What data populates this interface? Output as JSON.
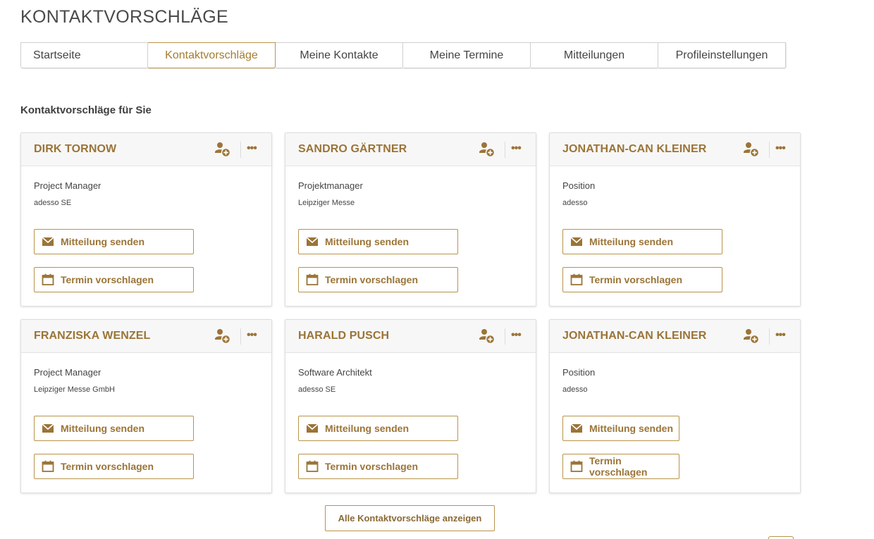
{
  "page": {
    "title": "KONTAKTVORSCHLÄGE"
  },
  "tabs": [
    {
      "label": "Startseite",
      "active": false
    },
    {
      "label": "Kontaktvorschläge",
      "active": true
    },
    {
      "label": "Meine Kontakte",
      "active": false
    },
    {
      "label": "Meine Termine",
      "active": false
    },
    {
      "label": "Mitteilungen",
      "active": false
    },
    {
      "label": "Profileinstellungen",
      "active": false
    }
  ],
  "section": {
    "heading": "Kontaktvorschläge für Sie"
  },
  "cards": [
    {
      "name": "DIRK TORNOW",
      "position": "Project Manager",
      "company": "adesso SE",
      "message_label": "Mitteilung senden",
      "appointment_label": "Termin vorschlagen",
      "more_label": "•••"
    },
    {
      "name": "SANDRO GÄRTNER",
      "position": "Projektmanager",
      "company": "Leipziger Messe",
      "message_label": "Mitteilung senden",
      "appointment_label": "Termin vorschlagen",
      "more_label": "•••"
    },
    {
      "name": "JONATHAN-CAN KLEINER",
      "position": "Position",
      "company": "adesso",
      "message_label": "Mitteilung senden",
      "appointment_label": "Termin vorschlagen",
      "more_label": "•••"
    },
    {
      "name": "FRANZISKA WENZEL",
      "position": "Project Manager",
      "company": "Leipziger Messe GmbH",
      "message_label": "Mitteilung senden",
      "appointment_label": "Termin vorschlagen",
      "more_label": "•••"
    },
    {
      "name": "HARALD PUSCH",
      "position": "Software Architekt",
      "company": "adesso SE",
      "message_label": "Mitteilung senden",
      "appointment_label": "Termin vorschlagen",
      "more_label": "•••"
    },
    {
      "name": "JONATHAN-CAN KLEINER",
      "position": "Position",
      "company": "adesso",
      "message_label": "Mitteilung senden",
      "appointment_label": "Termin vorschlagen",
      "more_label": "•••"
    }
  ],
  "footer": {
    "all_suggestions_label": "Alle Kontaktvorschläge anzeigen"
  },
  "icons": {
    "add_contact": "add-user-icon",
    "more": "more-dots-icon",
    "message": "envelope-icon",
    "appointment": "calendar-icon"
  },
  "colors": {
    "accent": "#9b7437",
    "accent_border": "#b8934a",
    "header_bg": "#f7f7f7"
  }
}
